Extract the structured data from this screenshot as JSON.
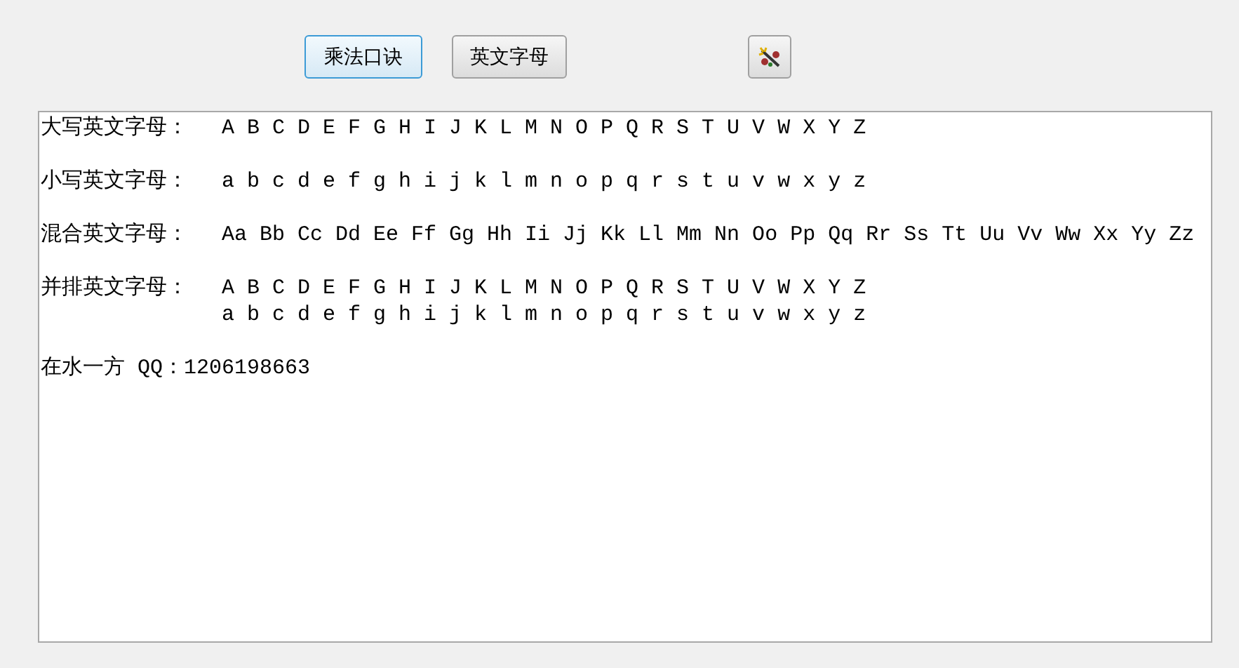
{
  "toolbar": {
    "buttons": [
      {
        "label": "乘法口诀",
        "focused": true
      },
      {
        "label": "英文字母",
        "focused": false
      }
    ]
  },
  "text_area": {
    "rows": [
      {
        "label": "大写英文字母：",
        "lines": [
          "A B C D E F G H I J K L M N O P Q R S T U V W X Y Z"
        ]
      },
      {
        "label": "小写英文字母：",
        "lines": [
          "a b c d e f g h i j k l m n o p q r s t u v w x y z"
        ]
      },
      {
        "label": "混合英文字母：",
        "lines": [
          "Aa Bb Cc Dd Ee Ff Gg Hh Ii Jj Kk Ll Mm Nn Oo Pp Qq Rr Ss Tt Uu Vv Ww Xx Yy Zz"
        ]
      },
      {
        "label": "并排英文字母：",
        "lines": [
          "A B C D E F G H I J K L M N O P Q R S T U V W X Y Z",
          "a b c d e f g h i j k l m n o p q r s t u v w x y z"
        ]
      },
      {
        "label": "在水一方 QQ：1206198663",
        "lines": []
      }
    ]
  }
}
